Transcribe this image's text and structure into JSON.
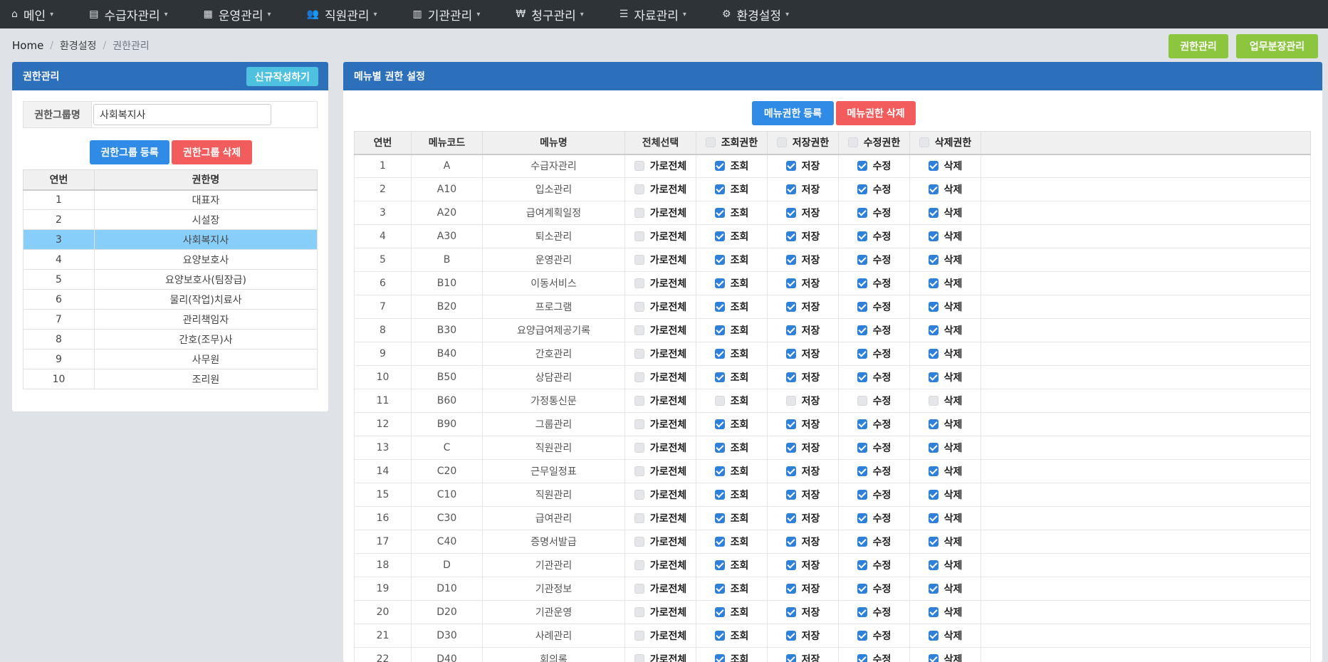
{
  "nav": [
    {
      "icon": "home-icon",
      "glyph": "⌂",
      "label": "메인"
    },
    {
      "icon": "id-card-icon",
      "glyph": "▤",
      "label": "수급자관리"
    },
    {
      "icon": "calendar-icon",
      "glyph": "▦",
      "label": "운영관리"
    },
    {
      "icon": "users-icon",
      "glyph": "👥",
      "label": "직원관리"
    },
    {
      "icon": "building-icon",
      "glyph": "▥",
      "label": "기관관리"
    },
    {
      "icon": "won-icon",
      "glyph": "₩",
      "label": "청구관리"
    },
    {
      "icon": "list-icon",
      "glyph": "☰",
      "label": "자료관리"
    },
    {
      "icon": "gear-icon",
      "glyph": "⚙",
      "label": "환경설정"
    }
  ],
  "breadcrumb": {
    "home": "Home",
    "section": "환경설정",
    "current": "권한관리"
  },
  "top_buttons": {
    "auth": "권한관리",
    "duty": "업무분장관리"
  },
  "left_panel": {
    "title": "권한관리",
    "new_button": "신규작성하기",
    "group_label": "권한그룹명",
    "group_value": "사회복지사",
    "register_button": "권한그룹 등록",
    "delete_button": "권한그룹 삭제",
    "table": {
      "headers": [
        "연번",
        "권한명"
      ],
      "selected_index": 2,
      "rows": [
        [
          "1",
          "대표자"
        ],
        [
          "2",
          "시설장"
        ],
        [
          "3",
          "사회복지사"
        ],
        [
          "4",
          "요양보호사"
        ],
        [
          "5",
          "요양보호사(팀장급)"
        ],
        [
          "6",
          "물리(작업)치료사"
        ],
        [
          "7",
          "관리책임자"
        ],
        [
          "8",
          "간호(조무)사"
        ],
        [
          "9",
          "사무원"
        ],
        [
          "10",
          "조리원"
        ]
      ]
    }
  },
  "right_panel": {
    "title": "메뉴별 권한 설정",
    "register_button": "메뉴권한 등록",
    "delete_button": "메뉴권한 삭제",
    "headers": {
      "no": "연번",
      "code": "메뉴코드",
      "name": "메뉴명",
      "all": "전체선택",
      "view": "조회권한",
      "save": "저장권한",
      "edit": "수정권한",
      "delete": "삭제권한"
    },
    "cell_labels": {
      "all": "가로전체",
      "view": "조회",
      "save": "저장",
      "edit": "수정",
      "delete": "삭제"
    },
    "rows": [
      {
        "no": "1",
        "code": "A",
        "name": "수급자관리",
        "on": true
      },
      {
        "no": "2",
        "code": "A10",
        "name": "입소관리",
        "on": true
      },
      {
        "no": "3",
        "code": "A20",
        "name": "급여계획일정",
        "on": true
      },
      {
        "no": "4",
        "code": "A30",
        "name": "퇴소관리",
        "on": true
      },
      {
        "no": "5",
        "code": "B",
        "name": "운영관리",
        "on": true
      },
      {
        "no": "6",
        "code": "B10",
        "name": "이동서비스",
        "on": true
      },
      {
        "no": "7",
        "code": "B20",
        "name": "프로그램",
        "on": true
      },
      {
        "no": "8",
        "code": "B30",
        "name": "요양급여제공기록",
        "on": true
      },
      {
        "no": "9",
        "code": "B40",
        "name": "간호관리",
        "on": true
      },
      {
        "no": "10",
        "code": "B50",
        "name": "상담관리",
        "on": true
      },
      {
        "no": "11",
        "code": "B60",
        "name": "가정통신문",
        "on": false
      },
      {
        "no": "12",
        "code": "B90",
        "name": "그룹관리",
        "on": true
      },
      {
        "no": "13",
        "code": "C",
        "name": "직원관리",
        "on": true
      },
      {
        "no": "14",
        "code": "C20",
        "name": "근무일정표",
        "on": true
      },
      {
        "no": "15",
        "code": "C10",
        "name": "직원관리",
        "on": true
      },
      {
        "no": "16",
        "code": "C30",
        "name": "급여관리",
        "on": true
      },
      {
        "no": "17",
        "code": "C40",
        "name": "증명서발급",
        "on": true
      },
      {
        "no": "18",
        "code": "D",
        "name": "기관관리",
        "on": true
      },
      {
        "no": "19",
        "code": "D10",
        "name": "기관정보",
        "on": true
      },
      {
        "no": "20",
        "code": "D20",
        "name": "기관운영",
        "on": true
      },
      {
        "no": "21",
        "code": "D30",
        "name": "사례관리",
        "on": true
      },
      {
        "no": "22",
        "code": "D40",
        "name": "회의록",
        "on": true
      }
    ]
  }
}
